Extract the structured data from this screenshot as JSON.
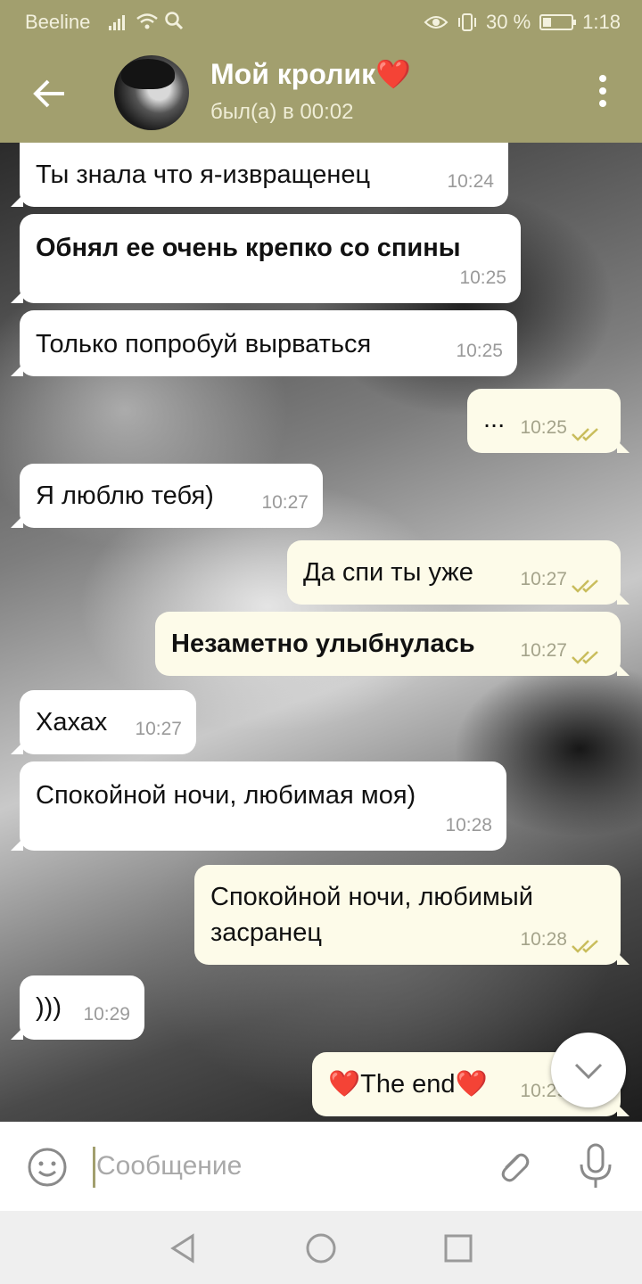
{
  "status_bar": {
    "carrier": "Beeline",
    "battery": "30 %",
    "battery_level": 0.3,
    "time": "1:18"
  },
  "chat_header": {
    "contact_name": "Мой кролик❤️",
    "last_seen": "был(а) в 00:02"
  },
  "messages": [
    {
      "direction": "in",
      "text": "Ты знала что я-извращенец",
      "time": "10:24",
      "bold": false
    },
    {
      "direction": "in",
      "text": "Обнял ее очень крепко со спины",
      "time": "10:25",
      "bold": true
    },
    {
      "direction": "in",
      "text": "Только попробуй вырваться",
      "time": "10:25",
      "bold": false
    },
    {
      "direction": "out",
      "text": "...",
      "time": "10:25",
      "bold": false,
      "read": true
    },
    {
      "direction": "in",
      "text": "Я люблю тебя)",
      "time": "10:27",
      "bold": false
    },
    {
      "direction": "out",
      "text": "Да спи ты уже",
      "time": "10:27",
      "bold": false,
      "read": true
    },
    {
      "direction": "out",
      "text": "Незаметно улыбнулась",
      "time": "10:27",
      "bold": true,
      "read": true
    },
    {
      "direction": "in",
      "text": "Хахах",
      "time": "10:27",
      "bold": false
    },
    {
      "direction": "in",
      "text": "Спокойной ночи, любимая моя)",
      "time": "10:28",
      "bold": false
    },
    {
      "direction": "out",
      "text_line1": "Спокойной ночи, любимый",
      "text_line2": "засранец",
      "time": "10:28",
      "bold": false,
      "read": true
    },
    {
      "direction": "in",
      "text": ")))",
      "time": "10:29",
      "bold": false
    },
    {
      "direction": "out",
      "text": "❤️The end❤️",
      "time": "10:29",
      "bold": false
    }
  ],
  "composer": {
    "placeholder": "Сообщение"
  },
  "icons": {
    "back": "arrow-left-icon",
    "menu": "more-vertical-icon",
    "emoji": "smiley-icon",
    "attach": "paperclip-icon",
    "mic": "microphone-icon",
    "scroll": "chevron-down-icon",
    "ticks": "double-check-icon"
  },
  "colors": {
    "header": "#a29f6e",
    "outgoing_bubble": "#fdfbe9",
    "incoming_bubble": "#ffffff",
    "read_ticks": "#c9bd5c"
  }
}
